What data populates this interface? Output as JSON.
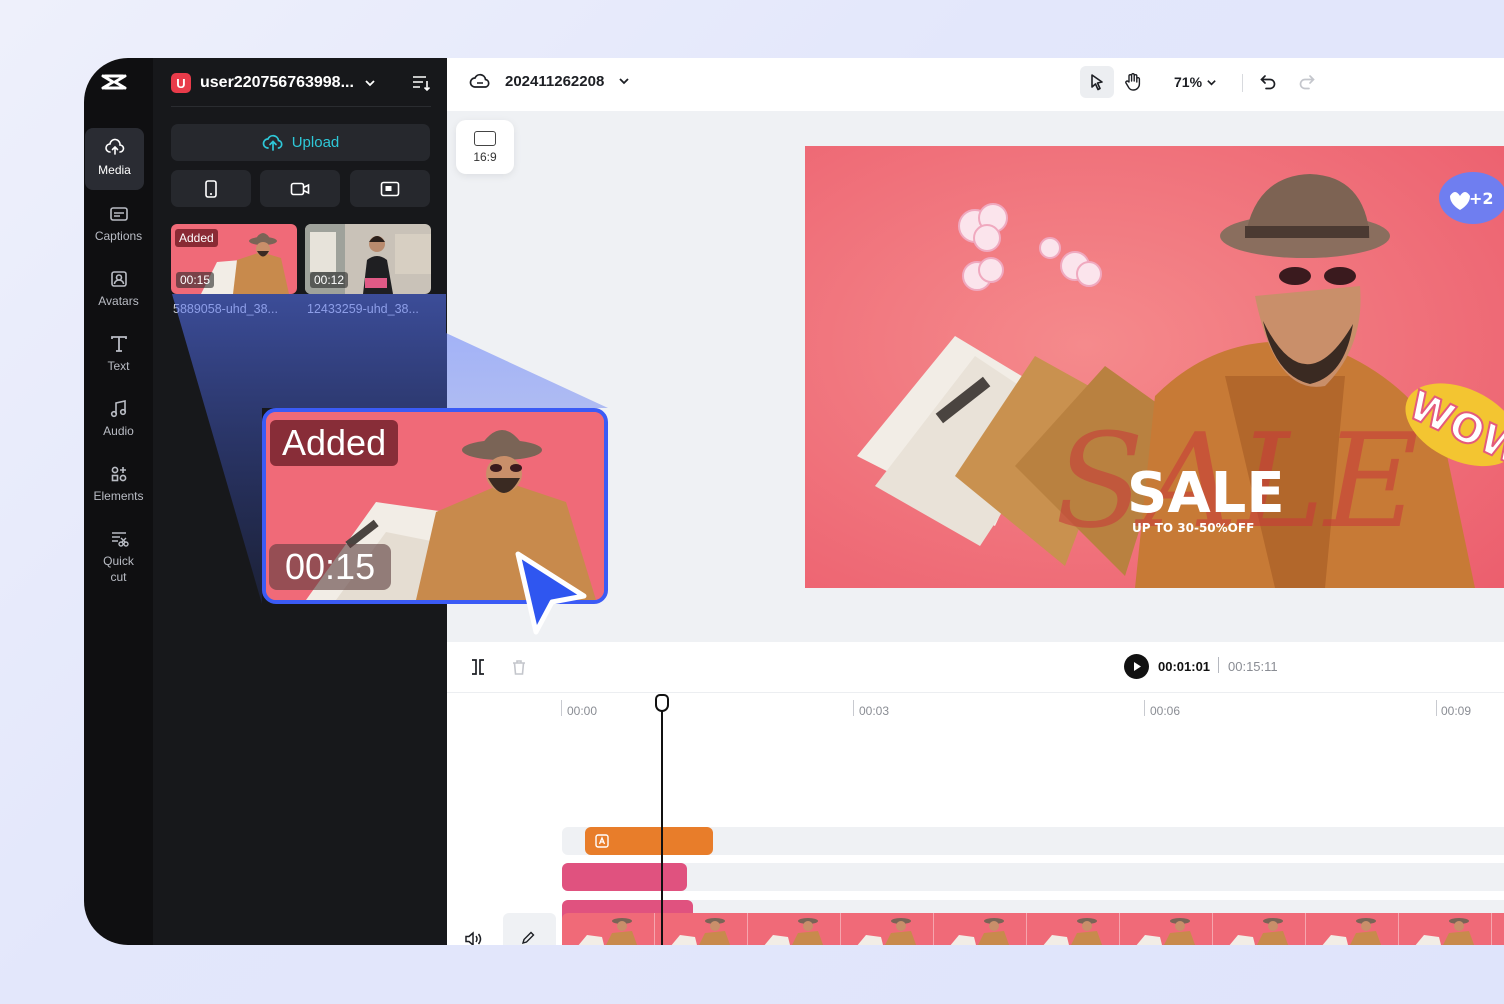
{
  "rail": {
    "items": [
      {
        "label": "Media",
        "icon": "cloud-upload-icon"
      },
      {
        "label": "Captions",
        "icon": "captions-icon"
      },
      {
        "label": "Avatars",
        "icon": "avatar-icon"
      },
      {
        "label": "Text",
        "icon": "text-icon"
      },
      {
        "label": "Audio",
        "icon": "music-note-icon"
      },
      {
        "label": "Elements",
        "icon": "elements-icon"
      },
      {
        "label": "Quick",
        "label2": "cut",
        "icon": "quick-cut-icon"
      }
    ]
  },
  "panel": {
    "avatar_letter": "U",
    "username": "user220756763998...",
    "upload_label": "Upload",
    "media": [
      {
        "badge": "Added",
        "duration": "00:15",
        "name": "5889058-uhd_38..."
      },
      {
        "badge": "",
        "duration": "00:12",
        "name": "12433259-uhd_38..."
      }
    ]
  },
  "topbar": {
    "project_name": "202411262208",
    "zoom": "71%"
  },
  "ratio": {
    "label": "16:9"
  },
  "canvas": {
    "sale_title": "SALE",
    "sale_sub": "UP TO 30-50%OFF",
    "sticker_likes": "+2",
    "sticker_wow": "WOW"
  },
  "timeline": {
    "current_time": "00:01:01",
    "total_time": "00:15:11",
    "ticks": [
      "00:00",
      "00:03",
      "00:06",
      "00:09"
    ]
  },
  "callout": {
    "badge": "Added",
    "duration": "00:15"
  },
  "colors": {
    "accent_blue": "#3b5bf5",
    "upload_cyan": "#2ec8d8",
    "clip_orange": "#e87d2a",
    "clip_pink": "#e0527f",
    "video_red": "#f06a78"
  }
}
